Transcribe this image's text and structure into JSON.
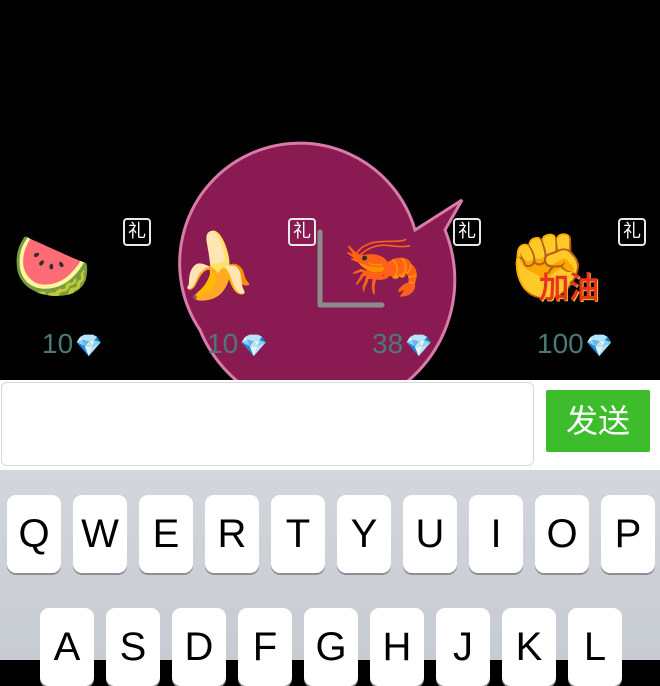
{
  "gifts": [
    {
      "name": "watermelon",
      "emoji": "🍉",
      "tag": "礼",
      "price": "10"
    },
    {
      "name": "banana",
      "emoji": "🍌",
      "tag": "礼",
      "price": "10"
    },
    {
      "name": "shrimp",
      "emoji": "🦐",
      "tag": "礼",
      "price": "38"
    },
    {
      "name": "cheer",
      "emoji": "✊",
      "tag": "礼",
      "price": "100"
    }
  ],
  "diamond_glyph": "💎",
  "cheer_text": "加油",
  "input": {
    "value": "",
    "placeholder": ""
  },
  "send_label": "发送",
  "keyboard": {
    "row1": [
      "Q",
      "W",
      "E",
      "R",
      "T",
      "Y",
      "U",
      "I",
      "O",
      "P"
    ],
    "row2": [
      "A",
      "S",
      "D",
      "F",
      "G",
      "H",
      "J",
      "K",
      "L"
    ]
  },
  "colors": {
    "bubble_fill": "#8a1a52",
    "bubble_stroke": "#d77ba8",
    "send_button": "#3dbd2c",
    "price_text": "#4b7a74"
  }
}
